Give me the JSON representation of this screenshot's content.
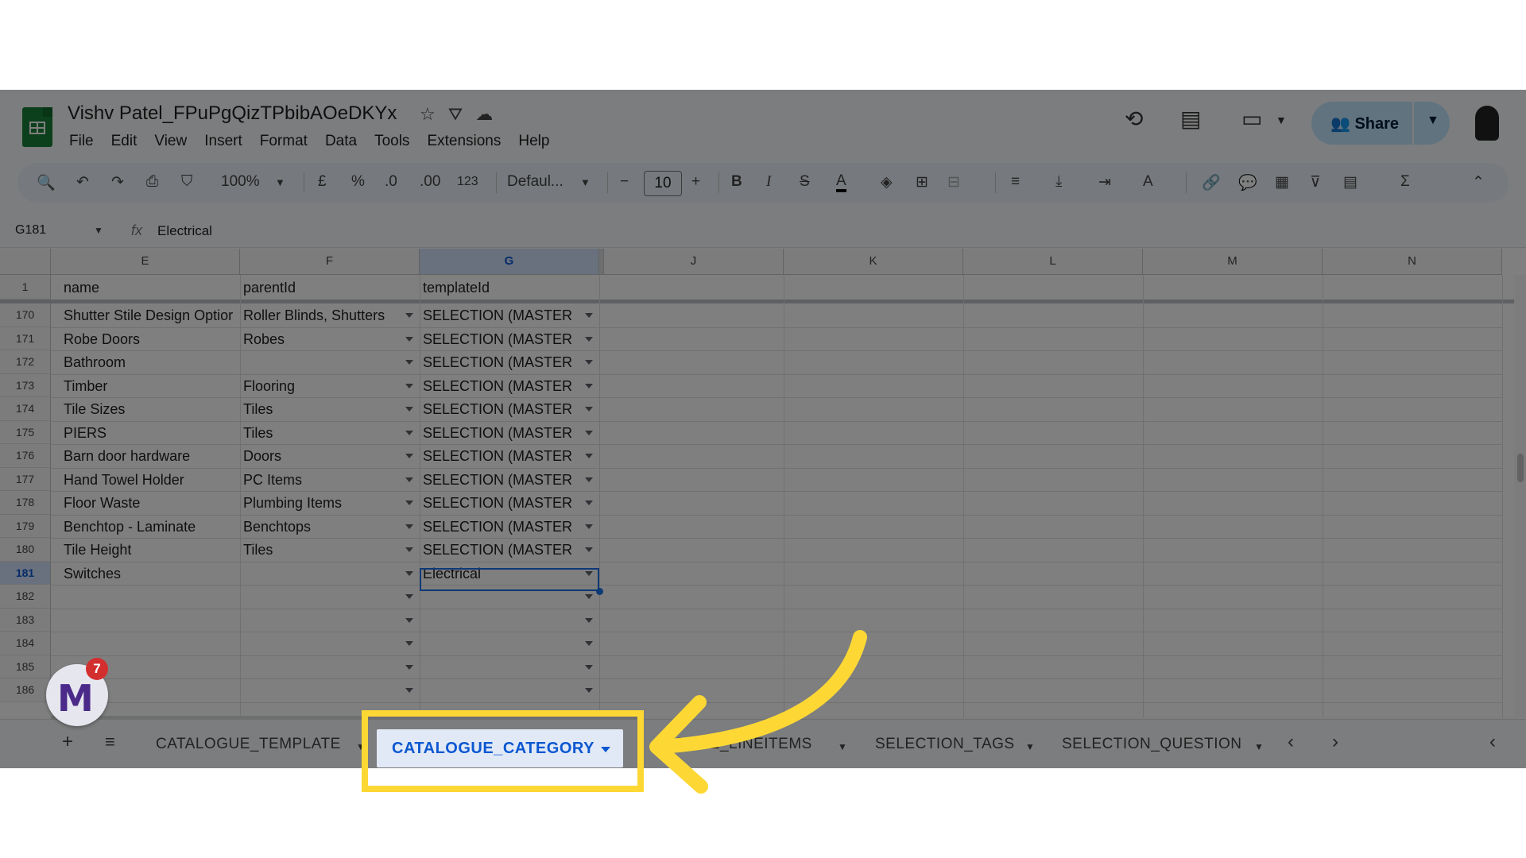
{
  "document": {
    "title": "Vishv Patel_FPuPgQizTPbibAOeDKYx"
  },
  "menu": [
    "File",
    "Edit",
    "View",
    "Insert",
    "Format",
    "Data",
    "Tools",
    "Extensions",
    "Help"
  ],
  "header": {
    "share_label": "Share"
  },
  "toolbar": {
    "zoom": "100%",
    "currency": "£",
    "percent": "%",
    "dec_decrease": ".0",
    "dec_increase": ".00",
    "number_format": "123",
    "font": "Defaul...",
    "font_size": "10"
  },
  "formula_bar": {
    "cell_ref": "G181",
    "fx": "fx",
    "value": "Electrical"
  },
  "columns": [
    "E",
    "F",
    "G",
    "J",
    "K",
    "L",
    "M",
    "N"
  ],
  "selected_column": "G",
  "header_row": {
    "row": "1",
    "name": "name",
    "parentId": "parentId",
    "templateId": "templateId"
  },
  "rows": [
    {
      "row": "170",
      "name": "Shutter Stile Design Optior",
      "parentId": "Roller Blinds, Shutters",
      "templateId": "SELECTION (MASTER"
    },
    {
      "row": "171",
      "name": "Robe Doors",
      "parentId": "Robes",
      "templateId": "SELECTION (MASTER"
    },
    {
      "row": "172",
      "name": "Bathroom",
      "parentId": "",
      "templateId": "SELECTION (MASTER"
    },
    {
      "row": "173",
      "name": "Timber",
      "parentId": "Flooring",
      "templateId": "SELECTION (MASTER"
    },
    {
      "row": "174",
      "name": "Tile Sizes",
      "parentId": "Tiles",
      "templateId": "SELECTION (MASTER"
    },
    {
      "row": "175",
      "name": "PIERS",
      "parentId": "Tiles",
      "templateId": "SELECTION (MASTER"
    },
    {
      "row": "176",
      "name": "Barn door hardware",
      "parentId": "Doors",
      "templateId": "SELECTION (MASTER"
    },
    {
      "row": "177",
      "name": "Hand Towel Holder",
      "parentId": "PC Items",
      "templateId": "SELECTION (MASTER"
    },
    {
      "row": "178",
      "name": "Floor Waste",
      "parentId": "Plumbing Items",
      "templateId": "SELECTION (MASTER"
    },
    {
      "row": "179",
      "name": "Benchtop - Laminate",
      "parentId": "Benchtops",
      "templateId": "SELECTION (MASTER"
    },
    {
      "row": "180",
      "name": "Tile Height",
      "parentId": "Tiles",
      "templateId": "SELECTION (MASTER"
    },
    {
      "row": "181",
      "name": "Switches",
      "parentId": "",
      "templateId": "Electrical"
    },
    {
      "row": "182",
      "name": "",
      "parentId": "",
      "templateId": ""
    },
    {
      "row": "183",
      "name": "",
      "parentId": "",
      "templateId": ""
    },
    {
      "row": "184",
      "name": "",
      "parentId": "",
      "templateId": ""
    },
    {
      "row": "185",
      "name": "",
      "parentId": "",
      "templateId": ""
    },
    {
      "row": "186",
      "name": "",
      "parentId": "",
      "templateId": ""
    }
  ],
  "selected_row": "181",
  "sheet_tabs": {
    "tab1": "CATALOGUE_TEMPLATE",
    "active": "CATALOGUE_CATEGORY",
    "tab3_partial": "OGUE_LINEITEMS",
    "tab4": "SELECTION_TAGS",
    "tab5": "SELECTION_QUESTION"
  },
  "overlay": {
    "badge_count": "7",
    "highlight_color": "#fdd835"
  }
}
